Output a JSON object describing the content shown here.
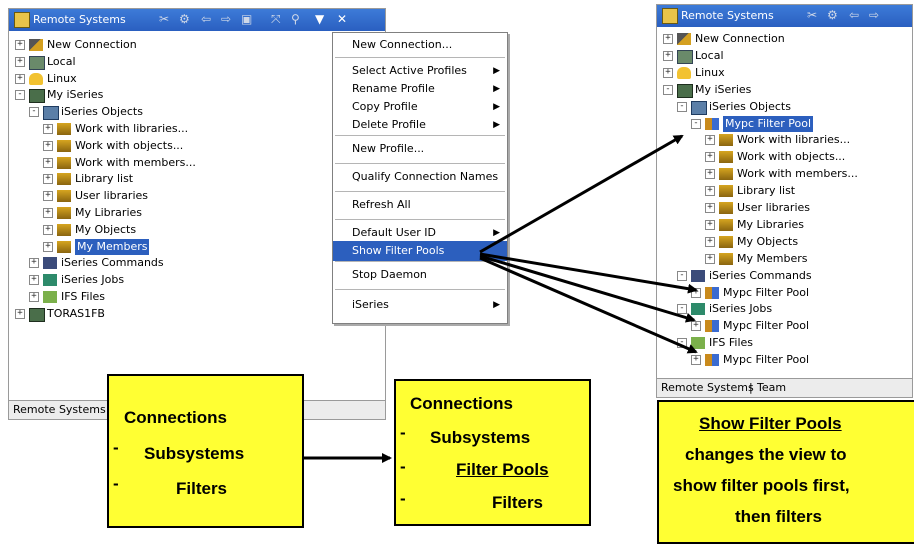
{
  "left_view": {
    "title": "Remote Systems",
    "tab_label": "Remote Systems",
    "tree": [
      {
        "label": "New Connection",
        "icon": "new-connection-icon",
        "exp": "+"
      },
      {
        "label": "Local",
        "icon": "local-system-icon",
        "exp": "+"
      },
      {
        "label": "Linux",
        "icon": "linux-icon",
        "exp": "+"
      },
      {
        "label": "My iSeries",
        "icon": "system-icon",
        "exp": "-"
      },
      {
        "label": "iSeries Objects",
        "icon": "subsystem-icon",
        "exp": "-"
      },
      {
        "label": "Work with libraries...",
        "icon": "filter-icon",
        "exp": "+"
      },
      {
        "label": "Work with objects...",
        "icon": "filter-icon",
        "exp": "+"
      },
      {
        "label": "Work with members...",
        "icon": "filter-icon",
        "exp": "+"
      },
      {
        "label": "Library list",
        "icon": "filter-icon",
        "exp": "+"
      },
      {
        "label": "User libraries",
        "icon": "filter-icon",
        "exp": "+"
      },
      {
        "label": "My Libraries",
        "icon": "filter-icon",
        "exp": "+"
      },
      {
        "label": "My Objects",
        "icon": "filter-icon",
        "exp": "+"
      },
      {
        "label": "My Members",
        "icon": "filter-icon",
        "exp": "+",
        "selected": true
      },
      {
        "label": "iSeries Commands",
        "icon": "commands-icon",
        "exp": "+"
      },
      {
        "label": "iSeries Jobs",
        "icon": "jobs-icon",
        "exp": "+"
      },
      {
        "label": "IFS Files",
        "icon": "ifs-icon",
        "exp": "+"
      },
      {
        "label": "TORAS1FB",
        "icon": "system-icon",
        "exp": "+"
      }
    ]
  },
  "context_menu": {
    "items": [
      {
        "label": "New Connection...",
        "sub": false
      },
      {
        "label": "Select Active Profiles",
        "sub": true
      },
      {
        "label": "Rename Profile",
        "sub": true
      },
      {
        "label": "Copy Profile",
        "sub": true
      },
      {
        "label": "Delete Profile",
        "sub": true
      },
      {
        "label": "New Profile...",
        "sub": false
      },
      {
        "label": "Qualify Connection Names",
        "sub": false
      },
      {
        "label": "Refresh All",
        "sub": false
      },
      {
        "label": "Default User ID",
        "sub": true
      },
      {
        "label": "Show Filter Pools",
        "sub": false,
        "highlighted": true
      },
      {
        "label": "Stop Daemon",
        "sub": false
      },
      {
        "label": "iSeries",
        "sub": true
      }
    ]
  },
  "right_view": {
    "title": "Remote Systems",
    "tabs": [
      "Remote Systems",
      "Team"
    ],
    "tree": [
      {
        "label": "New Connection",
        "icon": "new-connection-icon",
        "exp": "+"
      },
      {
        "label": "Local",
        "icon": "local-system-icon",
        "exp": "+"
      },
      {
        "label": "Linux",
        "icon": "linux-icon",
        "exp": "+"
      },
      {
        "label": "My iSeries",
        "icon": "system-icon",
        "exp": "-"
      },
      {
        "label": "iSeries Objects",
        "icon": "subsystem-icon",
        "exp": "-"
      },
      {
        "label": "Mypc Filter Pool",
        "icon": "filter-pool-icon",
        "exp": "-",
        "selected": true
      },
      {
        "label": "Work with libraries...",
        "icon": "filter-icon",
        "exp": "+"
      },
      {
        "label": "Work with objects...",
        "icon": "filter-icon",
        "exp": "+"
      },
      {
        "label": "Work with members...",
        "icon": "filter-icon",
        "exp": "+"
      },
      {
        "label": "Library list",
        "icon": "filter-icon",
        "exp": "+"
      },
      {
        "label": "User libraries",
        "icon": "filter-icon",
        "exp": "+"
      },
      {
        "label": "My Libraries",
        "icon": "filter-icon",
        "exp": "+"
      },
      {
        "label": "My Objects",
        "icon": "filter-icon",
        "exp": "+"
      },
      {
        "label": "My Members",
        "icon": "filter-icon",
        "exp": "+"
      },
      {
        "label": "iSeries Commands",
        "icon": "commands-icon",
        "exp": "-"
      },
      {
        "label": "Mypc Filter Pool",
        "icon": "filter-pool-icon",
        "exp": "+"
      },
      {
        "label": "iSeries Jobs",
        "icon": "jobs-icon",
        "exp": "-"
      },
      {
        "label": "Mypc Filter Pool",
        "icon": "filter-pool-icon",
        "exp": "+"
      },
      {
        "label": "IFS Files",
        "icon": "ifs-icon",
        "exp": "-"
      },
      {
        "label": "Mypc Filter Pool",
        "icon": "filter-pool-icon",
        "exp": "+"
      }
    ]
  },
  "callouts": {
    "before": {
      "line1": "Connections",
      "line2": "Subsystems",
      "line3": "Filters"
    },
    "after": {
      "line1": "Connections",
      "line2": "Subsystems",
      "line3": "Filter Pools",
      "line4": "Filters"
    },
    "explain": {
      "line1": "Show Filter Pools",
      "line2": "changes the view to",
      "line3": "show filter pools first,",
      "line4": "then filters"
    }
  },
  "colors": {
    "selection": "#2c5fbe",
    "callout": "#ffff33",
    "titlebar": "#3a72d4"
  }
}
